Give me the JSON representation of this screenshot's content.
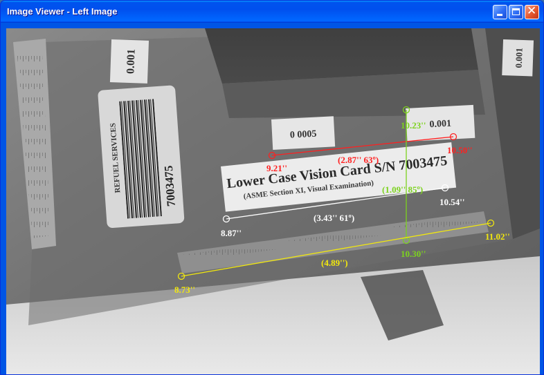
{
  "window": {
    "title": "Image Viewer - Left Image",
    "controls": [
      "minimize",
      "maximize",
      "close"
    ]
  },
  "image": {
    "sticker_top": "0.001",
    "sticker_top_right": "0.001",
    "sticker_mid": "0 0005",
    "sticker_right": "0.001",
    "barcode_label": "REFUEL SERVICES",
    "barcode_number": "7003475",
    "card_title": "Lower Case Vision Card S/N 7003475",
    "card_subtitle": "(ASME Section XI, Visual Examination)"
  },
  "measurements": {
    "red": {
      "color": "#ff2020",
      "start_label": "9.21''",
      "end_label": "10.50''",
      "value_label": "(2.87'' 63º)"
    },
    "white": {
      "color": "#ffffff",
      "start_label": "8.87''",
      "end_label": "10.54''",
      "value_label": "(3.43'' 61º)"
    },
    "green": {
      "color": "#7cd21e",
      "top_label": "10.23''",
      "bottom_label": "10.30''",
      "value_label": "(1.09'' 85º)"
    },
    "yellow": {
      "color": "#f2e80e",
      "start_label": "8.73''",
      "end_label": "11.02''",
      "value_label": "(4.89'')"
    }
  }
}
